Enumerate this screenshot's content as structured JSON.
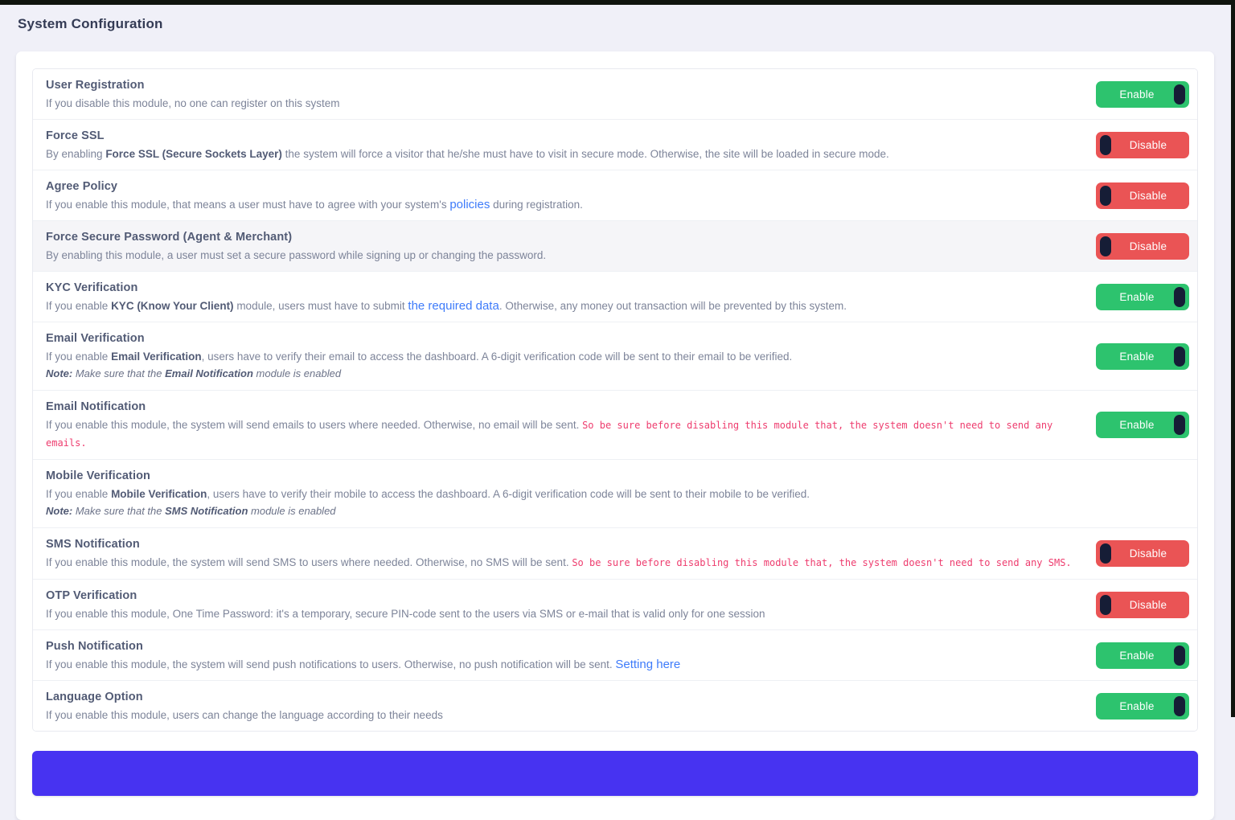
{
  "page": {
    "title": "System Configuration"
  },
  "toggle": {
    "enable_label": "Enable",
    "disable_label": "Disable"
  },
  "colors": {
    "page_background": "#f0f0f8",
    "enable_green": "#2dc36e",
    "disable_red": "#ea5455",
    "toggle_knob": "#161d36",
    "accent_purple": "#4733f1",
    "link_blue": "#3e7bfa",
    "warning_pink": "#ee3c6e",
    "title_dark": "#525b75",
    "description_gray": "#7d8499"
  },
  "modules": [
    {
      "title": "User Registration",
      "state": "enabled",
      "desc": [
        {
          "t": "If you disable this module, no one can register on this system"
        }
      ]
    },
    {
      "title": "Force SSL",
      "state": "disabled",
      "desc": [
        {
          "t": "By enabling "
        },
        {
          "t": "Force SSL (Secure Sockets Layer)",
          "b": true
        },
        {
          "t": " the system will force a visitor that he/she must have to visit in secure mode. Otherwise, the site will be loaded in secure mode."
        }
      ]
    },
    {
      "title": "Agree Policy",
      "state": "disabled",
      "desc": [
        {
          "t": "If you enable this module, that means a user must have to agree with your system's "
        },
        {
          "t": "policies",
          "link": true
        },
        {
          "t": " during registration."
        }
      ]
    },
    {
      "title": "Force Secure Password (Agent & Merchant)",
      "state": "disabled",
      "highlight": true,
      "desc": [
        {
          "t": "By enabling this module, a user must set a secure password while signing up or changing the password."
        }
      ]
    },
    {
      "title": "KYC Verification",
      "state": "enabled",
      "desc": [
        {
          "t": "If you enable "
        },
        {
          "t": "KYC (Know Your Client)",
          "b": true
        },
        {
          "t": " module, users must have to submit "
        },
        {
          "t": "the required data",
          "link": true
        },
        {
          "t": ". Otherwise, any money out transaction will be prevented by this system."
        }
      ]
    },
    {
      "title": "Email Verification",
      "state": "enabled",
      "desc": [
        {
          "t": "If you enable "
        },
        {
          "t": "Email Verification",
          "b": true
        },
        {
          "t": ", users have to verify their email to access the dashboard. A 6-digit verification code will be sent to their email to be verified."
        }
      ],
      "note": [
        {
          "t": "Note:",
          "b": true
        },
        {
          "t": " Make sure that the "
        },
        {
          "t": "Email Notification",
          "b": true
        },
        {
          "t": " module is enabled"
        }
      ]
    },
    {
      "title": "Email Notification",
      "state": "enabled",
      "desc": [
        {
          "t": "If you enable this module, the system will send emails to users where needed. Otherwise, no email will be sent. "
        },
        {
          "t": "So be sure before disabling this module that, the system doesn't need to send any emails.",
          "code": true
        }
      ]
    },
    {
      "title": "Mobile Verification",
      "state": "none",
      "desc": [
        {
          "t": "If you enable "
        },
        {
          "t": "Mobile Verification",
          "b": true
        },
        {
          "t": ", users have to verify their mobile to access the dashboard. A 6-digit verification code will be sent to their mobile to be verified."
        }
      ],
      "note": [
        {
          "t": "Note:",
          "b": true
        },
        {
          "t": " Make sure that the "
        },
        {
          "t": "SMS Notification",
          "b": true
        },
        {
          "t": " module is enabled"
        }
      ]
    },
    {
      "title": "SMS Notification",
      "state": "disabled",
      "desc": [
        {
          "t": "If you enable this module, the system will send SMS to users where needed. Otherwise, no SMS will be sent. "
        },
        {
          "t": "So be sure before disabling this module that, the system doesn't need to send any SMS.",
          "code": true
        }
      ]
    },
    {
      "title": "OTP Verification",
      "state": "disabled",
      "desc": [
        {
          "t": "If you enable this module, One Time Password: it's a temporary, secure PIN-code sent to the users via SMS or e-mail that is valid only for one session"
        }
      ]
    },
    {
      "title": "Push Notification",
      "state": "enabled",
      "desc": [
        {
          "t": "If you enable this module, the system will send push notifications to users. Otherwise, no push notification will be sent. "
        },
        {
          "t": "Setting here",
          "link": true
        }
      ]
    },
    {
      "title": "Language Option",
      "state": "enabled",
      "desc": [
        {
          "t": "If you enable this module, users can change the language according to their needs"
        }
      ]
    }
  ],
  "footer": {
    "submit_button_text_visible": ""
  }
}
